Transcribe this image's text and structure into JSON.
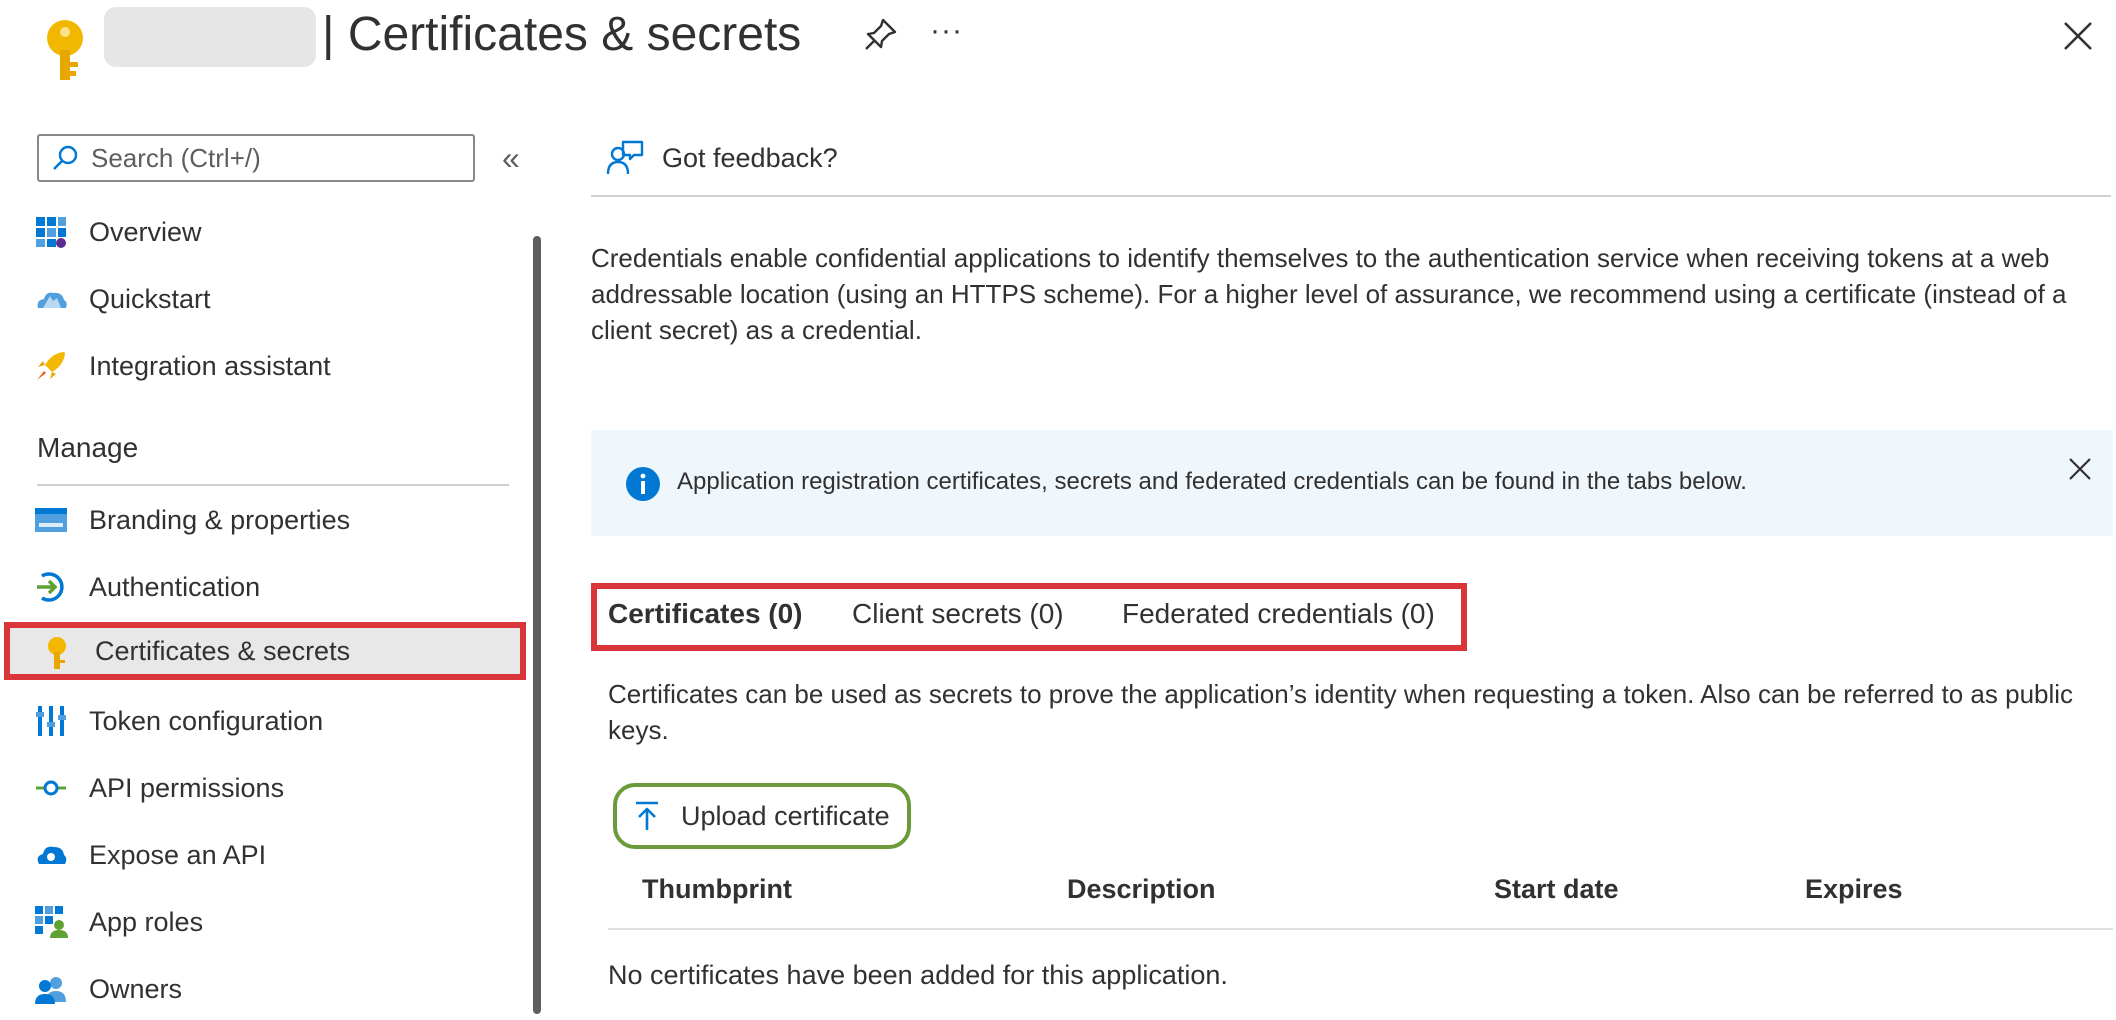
{
  "header": {
    "title_separator": "|",
    "title": "Certificates & secrets",
    "more_label": "···"
  },
  "sidebar": {
    "search_placeholder": "Search (Ctrl+/)",
    "collapse_label": "«",
    "items_top": [
      {
        "label": "Overview",
        "icon": "overview-icon"
      },
      {
        "label": "Quickstart",
        "icon": "quickstart-icon"
      },
      {
        "label": "Integration assistant",
        "icon": "rocket-icon"
      }
    ],
    "group_manage": "Manage",
    "items_manage": [
      {
        "label": "Branding & properties",
        "icon": "branding-icon"
      },
      {
        "label": "Authentication",
        "icon": "authentication-icon"
      },
      {
        "label": "Certificates & secrets",
        "icon": "key-icon",
        "selected": true
      },
      {
        "label": "Token configuration",
        "icon": "token-icon"
      },
      {
        "label": "API permissions",
        "icon": "api-permissions-icon"
      },
      {
        "label": "Expose an API",
        "icon": "cloud-api-icon"
      },
      {
        "label": "App roles",
        "icon": "app-roles-icon"
      },
      {
        "label": "Owners",
        "icon": "owners-icon"
      }
    ]
  },
  "toolbar": {
    "feedback_label": "Got feedback?"
  },
  "main": {
    "intro": "Credentials enable confidential applications to identify themselves to the authentication service when receiving tokens at a web addressable location (using an HTTPS scheme). For a higher level of assurance, we recommend using a certificate (instead of a client secret) as a credential.",
    "banner_text": "Application registration certificates, secrets and federated credentials can be found in the tabs below.",
    "tabs": [
      {
        "label": "Certificates (0)",
        "active": true
      },
      {
        "label": "Client secrets (0)",
        "active": false
      },
      {
        "label": "Federated credentials (0)",
        "active": false
      }
    ],
    "tab_description": "Certificates can be used as secrets to prove the application’s identity when requesting a token. Also can be referred to as public keys.",
    "upload_label": "Upload certificate",
    "columns": [
      "Thumbprint",
      "Description",
      "Start date",
      "Expires"
    ],
    "empty_message": "No certificates have been added for this application."
  },
  "colors": {
    "highlight_red": "#d9353b",
    "highlight_green": "#6a9a3a",
    "accent_blue": "#0078d4",
    "key_yellow": "#f2b800",
    "banner_bg": "#eff6fc"
  }
}
